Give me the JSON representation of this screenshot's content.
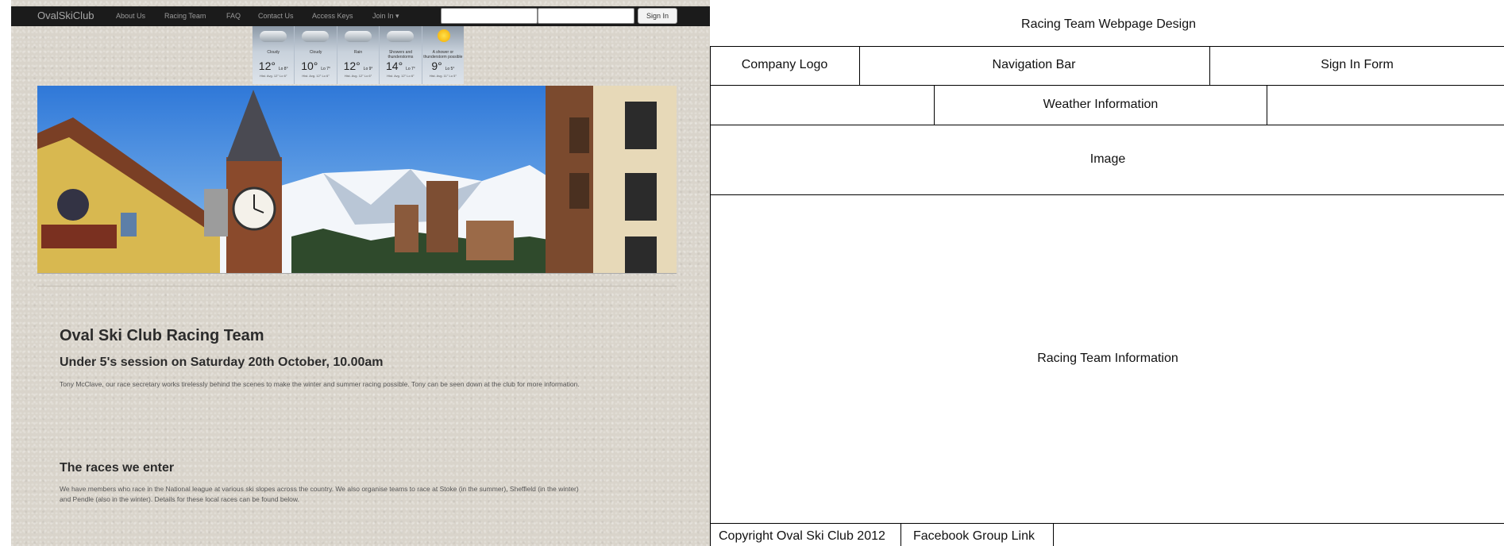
{
  "site": {
    "brand": "OvalSkiClub",
    "nav_links": [
      "About Us",
      "Racing Team",
      "FAQ",
      "Contact Us",
      "Access Keys",
      "Join In ▾"
    ],
    "signin_label": "Sign In",
    "username_placeholder": "",
    "password_placeholder": "",
    "weather": [
      {
        "condition": "Cloudy",
        "high": "12°",
        "low": "Lo 8°",
        "avg": "Hist. Avg. 12° Lo 6°",
        "icon": "cloud-icon"
      },
      {
        "condition": "Cloudy",
        "high": "10°",
        "low": "Lo 7°",
        "avg": "Hist. Avg. 12° Lo 6°",
        "icon": "cloud-icon"
      },
      {
        "condition": "Rain",
        "high": "12°",
        "low": "Lo 9°",
        "avg": "Hist. Avg. 12° Lo 6°",
        "icon": "rain-cloud-icon"
      },
      {
        "condition": "Showers and thunderstorms",
        "high": "14°",
        "low": "Lo 7°",
        "avg": "Hist. Avg. 12° Lo 6°",
        "icon": "storm-cloud-icon"
      },
      {
        "condition": "A shower or thunderstorm possible",
        "high": "9°",
        "low": "Lo 5°",
        "avg": "Hist. Avg. 11° Lo 5°",
        "icon": "sun-shower-icon"
      }
    ],
    "hero_alt": "Ski resort village with clock tower and snowy mountains",
    "heading": "Oval Ski Club Racing Team",
    "subheading": "Under 5's session on Saturday 20th October, 10.00am",
    "paragraph1": "Tony McClave, our race secretary works tirelessly behind the scenes to make the winter and summer racing possible. Tony can be seen down at the club for more information.",
    "section2_heading": "The races we enter",
    "paragraph2_line1": "We have members who race in the National league at various ski slopes across the country. We also organise teams to race at Stoke (in the summer), Sheffield (in the winter)",
    "paragraph2_line2": "and Pendle (also in the winter). Details for these local races can be found below."
  },
  "wireframe": {
    "title": "Racing Team Webpage Design",
    "company_logo": "Company Logo",
    "navigation_bar": "Navigation Bar",
    "sign_in_form": "Sign In Form",
    "weather_information": "Weather Information",
    "image": "Image",
    "racing_team_information": "Racing Team Information",
    "copyright": "Copyright Oval Ski Club 2012",
    "facebook_link": "Facebook Group Link"
  }
}
